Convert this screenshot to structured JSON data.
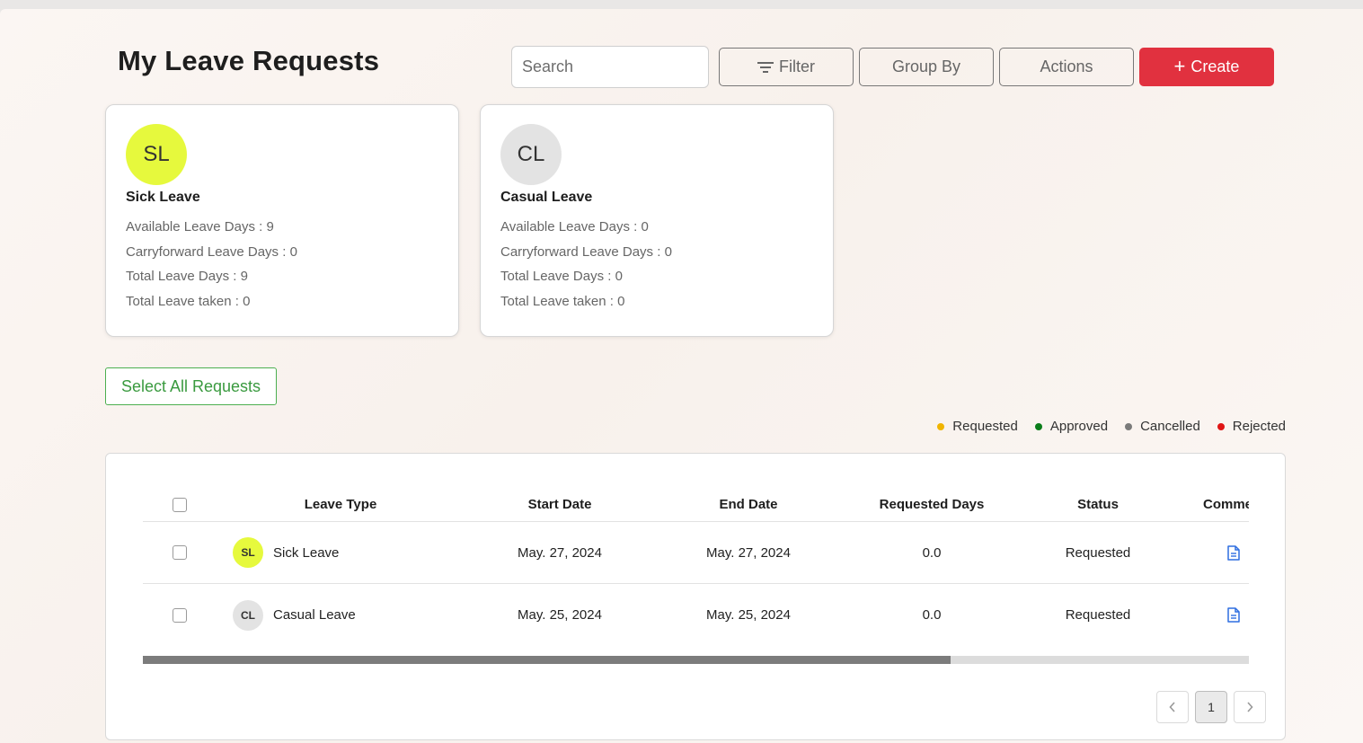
{
  "header": {
    "title": "My Leave Requests",
    "search_placeholder": "Search",
    "filter_label": "Filter",
    "group_by_label": "Group By",
    "actions_label": "Actions",
    "create_label": "Create"
  },
  "cards": [
    {
      "initials": "SL",
      "name": "Sick Leave",
      "color": "#e6f93d",
      "available": "Available Leave Days : 9",
      "carryforward": "Carryforward Leave Days : 0",
      "total": "Total Leave Days : 9",
      "taken": "Total Leave taken : 0"
    },
    {
      "initials": "CL",
      "name": "Casual Leave",
      "color": "#e3e3e3",
      "available": "Available Leave Days : 0",
      "carryforward": "Carryforward Leave Days : 0",
      "total": "Total Leave Days : 0",
      "taken": "Total Leave taken : 0"
    }
  ],
  "select_all_label": "Select All Requests",
  "legend": [
    {
      "label": "Requested",
      "color": "#f0b400"
    },
    {
      "label": "Approved",
      "color": "#0a7d1a"
    },
    {
      "label": "Cancelled",
      "color": "#7a7a7a"
    },
    {
      "label": "Rejected",
      "color": "#e01515"
    }
  ],
  "table": {
    "columns": [
      "Leave Type",
      "Start Date",
      "End Date",
      "Requested Days",
      "Status",
      "Comment"
    ],
    "rows": [
      {
        "initials": "SL",
        "color": "#e6f93d",
        "type": "Sick Leave",
        "start": "May. 27, 2024",
        "end": "May. 27, 2024",
        "days": "0.0",
        "status": "Requested",
        "comment_icon": "document-icon"
      },
      {
        "initials": "CL",
        "color": "#e3e3e3",
        "type": "Casual Leave",
        "start": "May. 25, 2024",
        "end": "May. 25, 2024",
        "days": "0.0",
        "status": "Requested",
        "comment_icon": "document-icon"
      }
    ],
    "horizontal_scroll_visible_fraction": 0.73
  },
  "pagination": {
    "current_page": "1"
  }
}
